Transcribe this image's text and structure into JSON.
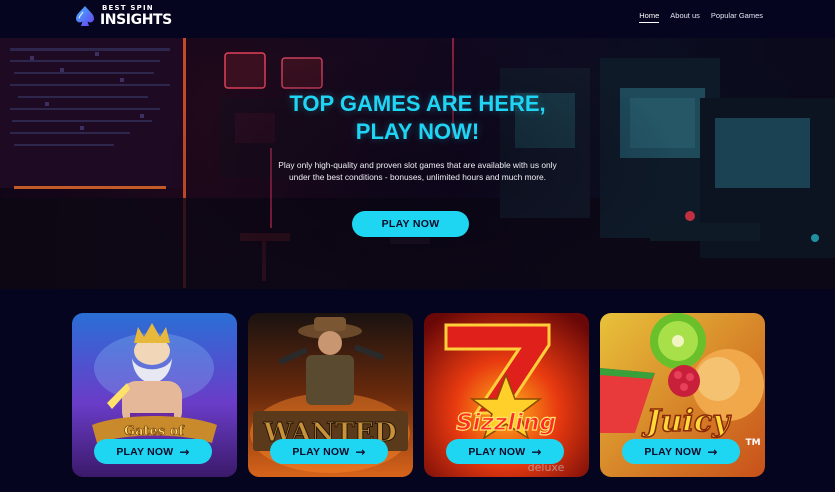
{
  "header": {
    "logo": {
      "line1": "BEST SPIN",
      "line2": "INSIGHTS"
    },
    "nav": [
      {
        "label": "Home",
        "active": true
      },
      {
        "label": "About us",
        "active": false
      },
      {
        "label": "Popular Games",
        "active": false
      }
    ]
  },
  "hero": {
    "title_line1": "TOP GAMES ARE HERE,",
    "title_line2": "PLAY NOW!",
    "description": "Play only high-quality and proven slot games that are available with us only under the best conditions - bonuses, unlimited hours and much more.",
    "button_label": "PLAY NOW"
  },
  "games": {
    "button_label": "PLAY NOW",
    "arrow_icon": "arrow-right-icon",
    "items": [
      {
        "title": "Gates of Olympus",
        "logo_text": "Gates of"
      },
      {
        "title": "Wanted",
        "logo_text": "WANTED"
      },
      {
        "title": "Sizzling Hot deluxe",
        "logo_text": "Sizzling"
      },
      {
        "title": "Juicy Fruits",
        "logo_text": "Juicy"
      }
    ]
  },
  "colors": {
    "background": "#050520",
    "accent": "#1fd6f2",
    "title": "#20d4f4"
  }
}
